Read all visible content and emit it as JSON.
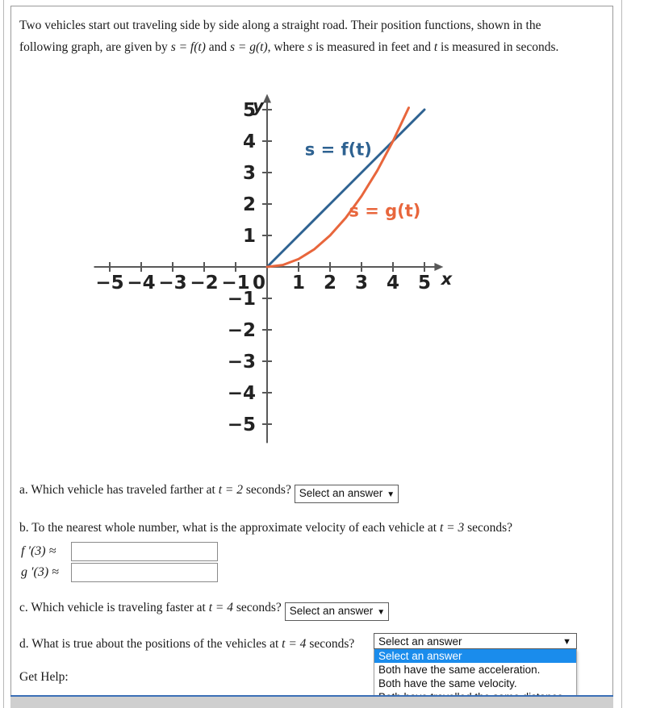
{
  "problem": {
    "line1_a": "Two vehicles start out traveling side by side along a straight road. Their position functions, shown in the",
    "line2_a": "following graph, are given by ",
    "line2_b": "s = f(t)",
    "line2_c": " and ",
    "line2_d": "s = g(t)",
    "line2_e": ", where ",
    "line2_f": "s",
    "line2_g": " is measured in feet and ",
    "line2_h": "t",
    "line2_i": " is measured in seconds."
  },
  "chart_data": {
    "type": "line",
    "title": "",
    "xlabel": "x",
    "ylabel": "y",
    "xlim": [
      -5.5,
      5.6
    ],
    "ylim": [
      -5.6,
      5.5
    ],
    "grid": false,
    "legend": "inline-annotations",
    "x_ticks": [
      -5,
      -4,
      -3,
      -2,
      -1,
      0,
      1,
      2,
      3,
      4,
      5
    ],
    "x_tick_labels": [
      "−5",
      "−4",
      "−3",
      "−2",
      "−1",
      "0",
      "1",
      "2",
      "3",
      "4",
      "5"
    ],
    "y_ticks": [
      -5,
      -4,
      -3,
      -2,
      -1,
      1,
      2,
      3,
      4,
      5
    ],
    "y_tick_labels": [
      "−5",
      "−4",
      "−3",
      "−2",
      "−1",
      "1",
      "2",
      "3",
      "4",
      "5"
    ],
    "origin_label": "0",
    "series": [
      {
        "name": "s = f(t)",
        "color": "#2E6291",
        "label": "s = f(t)",
        "label_x": 1.2,
        "label_y": 3.55,
        "x": [
          0,
          1,
          2,
          3,
          4,
          5
        ],
        "values": [
          0,
          1,
          2,
          3,
          4,
          5
        ]
      },
      {
        "name": "s = g(t)",
        "color": "#E8663C",
        "label": "s = g(t)",
        "label_x": 2.6,
        "label_y": 1.6,
        "x": [
          0,
          0.5,
          1,
          1.5,
          2,
          2.5,
          3,
          3.5,
          4,
          4.5
        ],
        "values": [
          0,
          0.06,
          0.25,
          0.56,
          1.0,
          1.56,
          2.25,
          3.06,
          4.0,
          5.06
        ]
      }
    ]
  },
  "questions": {
    "a": {
      "prefix": "a. Which vehicle has traveled farther at ",
      "math": "t = 2",
      "suffix": " seconds?",
      "select_label": "Select an answer",
      "caret": "⌄"
    },
    "b": {
      "prefix": "b. To the nearest whole number, what is the approximate velocity of each vehicle at ",
      "math": "t = 3",
      "suffix": " seconds?",
      "f_label": "f ′(3) ≈",
      "g_label": "g ′(3) ≈",
      "f_value": "",
      "g_value": "",
      "f_placeholder": "",
      "g_placeholder": ""
    },
    "c": {
      "prefix": "c. Which vehicle is traveling faster at ",
      "math": "t = 4",
      "suffix": " seconds?",
      "select_label": "Select an answer",
      "caret": "⌄"
    },
    "d": {
      "prefix": "d. What is true about the positions of the vehicles at ",
      "math": "t = 4",
      "suffix": " seconds?",
      "selected_value": "Select an answer",
      "caret": "⌄",
      "options": [
        "Select an answer",
        "Both have the same acceleration.",
        "Both have the same velocity.",
        "Both have travelled the same distance."
      ],
      "highlighted_index": 0
    }
  },
  "get_help": {
    "label": "Get Help:"
  },
  "colors": {
    "f_blue": "#2E6291",
    "g_orange": "#E8663C",
    "highlight": "#1a8cec",
    "bottom_bar": "#cfcfcf",
    "bottom_bar_border": "#3b6fb6"
  }
}
